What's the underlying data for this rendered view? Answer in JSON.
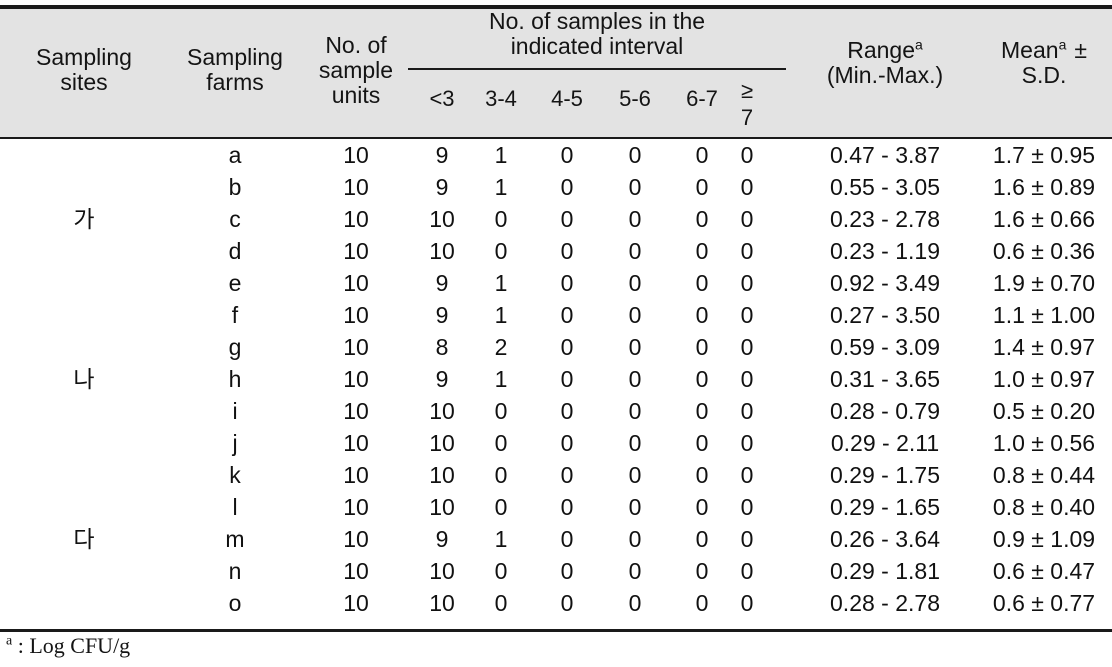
{
  "table": {
    "header": {
      "sampling_sites": "Sampling\nsites",
      "sampling_sites_l1": "Sampling",
      "sampling_sites_l2": "sites",
      "sampling_farms_l1": "Sampling",
      "sampling_farms_l2": "farms",
      "sample_units_l1": "No. of",
      "sample_units_l2": "sample",
      "sample_units_l3": "units",
      "interval_group_l1": "No. of  samples in the",
      "interval_group_l2": "indicated  interval",
      "interval_columns": [
        "<3",
        "3-4",
        "4-5",
        "5-6",
        "6-7"
      ],
      "interval_last_l1": "≥",
      "interval_last_l2": "7",
      "range_label": "Range",
      "range_sup": "a",
      "range_sub": "(Min.-Max.)",
      "mean_label": "Mean",
      "mean_sup": "a",
      "mean_pm": "±",
      "mean_sd": "S.D."
    },
    "rows": [
      {
        "site": "",
        "farm": "a",
        "units": "10",
        "i1": "9",
        "i2": "1",
        "i3": "0",
        "i4": "0",
        "i5": "0",
        "i6": "0",
        "range": "0.47  -  3.87",
        "mean": "1.7  ±  0.95"
      },
      {
        "site": "",
        "farm": "b",
        "units": "10",
        "i1": "9",
        "i2": "1",
        "i3": "0",
        "i4": "0",
        "i5": "0",
        "i6": "0",
        "range": "0.55  -  3.05",
        "mean": "1.6  ±  0.89"
      },
      {
        "site": "가",
        "farm": "c",
        "units": "10",
        "i1": "10",
        "i2": "0",
        "i3": "0",
        "i4": "0",
        "i5": "0",
        "i6": "0",
        "range": "0.23  -  2.78",
        "mean": "1.6  ±  0.66"
      },
      {
        "site": "",
        "farm": "d",
        "units": "10",
        "i1": "10",
        "i2": "0",
        "i3": "0",
        "i4": "0",
        "i5": "0",
        "i6": "0",
        "range": "0.23  -  1.19",
        "mean": "0.6  ±  0.36"
      },
      {
        "site": "",
        "farm": "e",
        "units": "10",
        "i1": "9",
        "i2": "1",
        "i3": "0",
        "i4": "0",
        "i5": "0",
        "i6": "0",
        "range": "0.92  -  3.49",
        "mean": "1.9  ±  0.70"
      },
      {
        "site": "",
        "farm": "f",
        "units": "10",
        "i1": "9",
        "i2": "1",
        "i3": "0",
        "i4": "0",
        "i5": "0",
        "i6": "0",
        "range": "0.27  -  3.50",
        "mean": "1.1  ±  1.00"
      },
      {
        "site": "",
        "farm": "g",
        "units": "10",
        "i1": "8",
        "i2": "2",
        "i3": "0",
        "i4": "0",
        "i5": "0",
        "i6": "0",
        "range": "0.59  -  3.09",
        "mean": "1.4  ±  0.97"
      },
      {
        "site": "나",
        "farm": "h",
        "units": "10",
        "i1": "9",
        "i2": "1",
        "i3": "0",
        "i4": "0",
        "i5": "0",
        "i6": "0",
        "range": "0.31  -  3.65",
        "mean": "1.0  ±  0.97"
      },
      {
        "site": "",
        "farm": "i",
        "units": "10",
        "i1": "10",
        "i2": "0",
        "i3": "0",
        "i4": "0",
        "i5": "0",
        "i6": "0",
        "range": "0.28  -  0.79",
        "mean": "0.5  ±  0.20"
      },
      {
        "site": "",
        "farm": "j",
        "units": "10",
        "i1": "10",
        "i2": "0",
        "i3": "0",
        "i4": "0",
        "i5": "0",
        "i6": "0",
        "range": "0.29  -  2.11",
        "mean": "1.0  ±  0.56"
      },
      {
        "site": "",
        "farm": "k",
        "units": "10",
        "i1": "10",
        "i2": "0",
        "i3": "0",
        "i4": "0",
        "i5": "0",
        "i6": "0",
        "range": "0.29  -  1.75",
        "mean": "0.8  ±  0.44"
      },
      {
        "site": "",
        "farm": "l",
        "units": "10",
        "i1": "10",
        "i2": "0",
        "i3": "0",
        "i4": "0",
        "i5": "0",
        "i6": "0",
        "range": "0.29  -  1.65",
        "mean": "0.8  ±  0.40"
      },
      {
        "site": "다",
        "farm": "m",
        "units": "10",
        "i1": "9",
        "i2": "1",
        "i3": "0",
        "i4": "0",
        "i5": "0",
        "i6": "0",
        "range": "0.26  -  3.64",
        "mean": "0.9  ±  1.09"
      },
      {
        "site": "",
        "farm": "n",
        "units": "10",
        "i1": "10",
        "i2": "0",
        "i3": "0",
        "i4": "0",
        "i5": "0",
        "i6": "0",
        "range": "0.29  -  1.81",
        "mean": "0.6  ±  0.47"
      },
      {
        "site": "",
        "farm": "o",
        "units": "10",
        "i1": "10",
        "i2": "0",
        "i3": "0",
        "i4": "0",
        "i5": "0",
        "i6": "0",
        "range": "0.28  -  2.78",
        "mean": "0.6  ±  0.77"
      }
    ],
    "footnote": {
      "sup": "a",
      "text": " :  Log  CFU/g"
    },
    "colors": {
      "header_background": "#e3e3e3",
      "rule": "#1a1a1a",
      "text": "#111111"
    }
  }
}
